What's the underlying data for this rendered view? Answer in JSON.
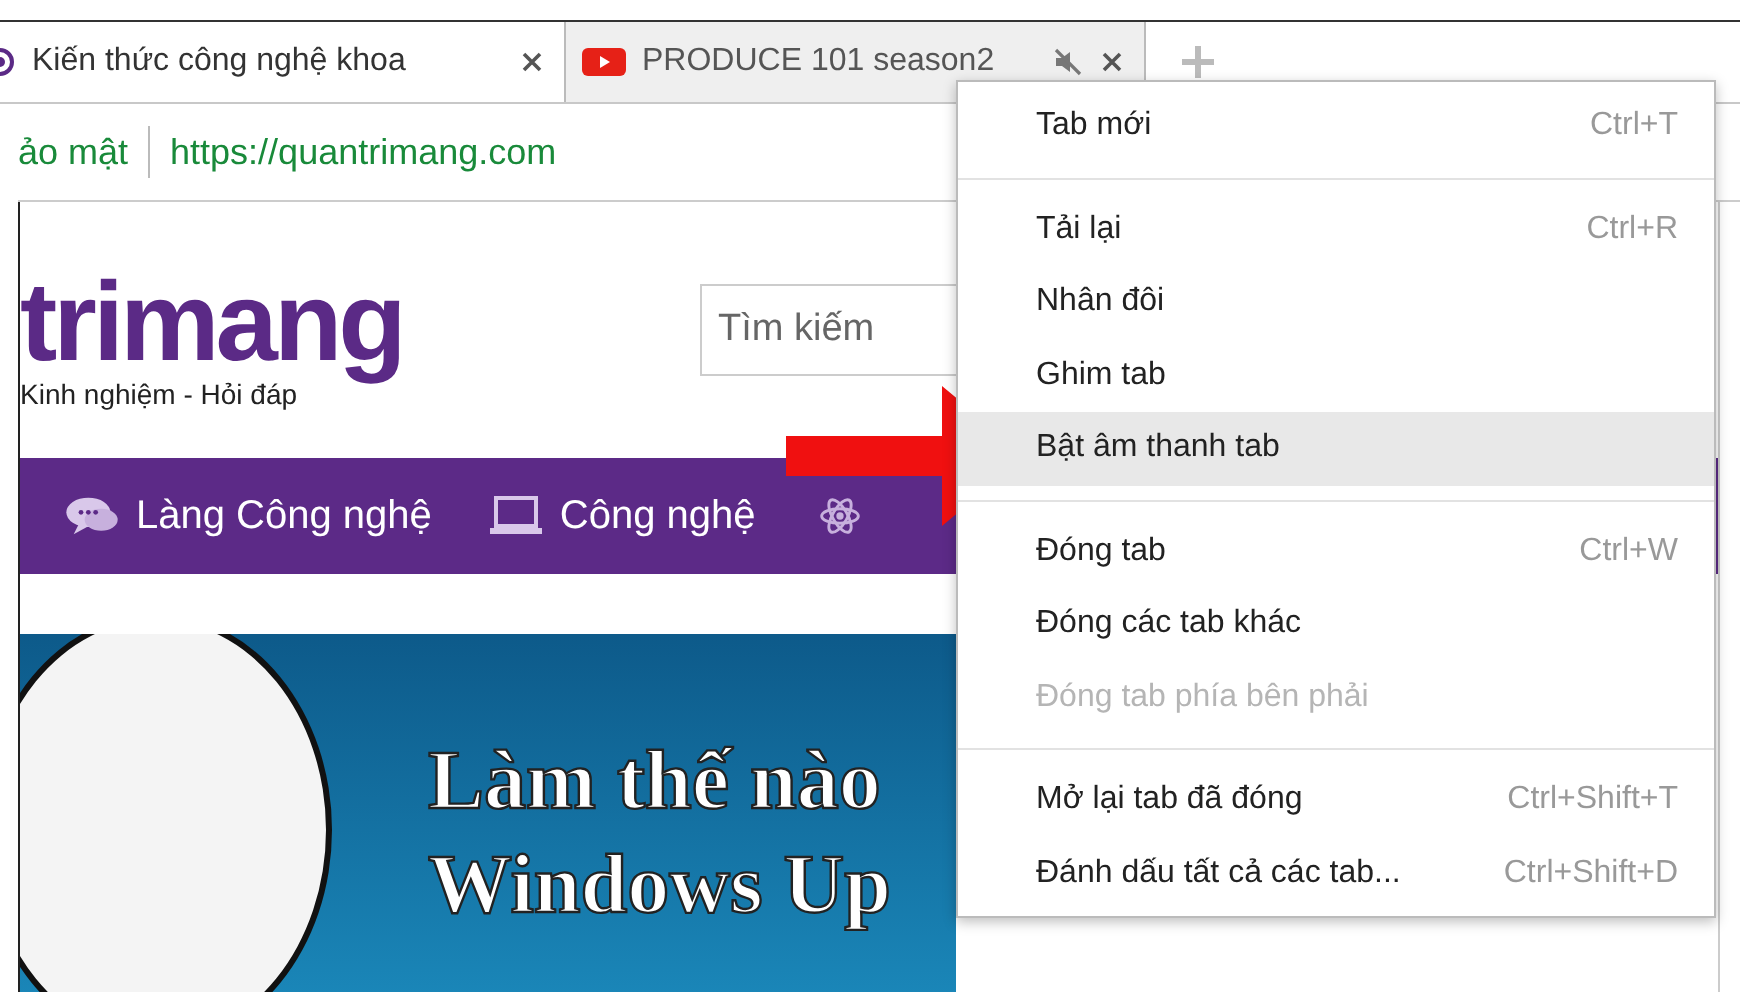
{
  "tabs": [
    {
      "title": "Kiến thức công nghệ khoa",
      "selected": true,
      "kind": "site",
      "muted": false
    },
    {
      "title": "PRODUCE 101 season2",
      "selected": false,
      "kind": "video",
      "muted": true
    }
  ],
  "address_bar": {
    "security_label": "ảo mật",
    "url": "https://quantrimang.com"
  },
  "site": {
    "logo_text": "trimang",
    "tagline": "Kinh nghiệm - Hỏi đáp",
    "search": {
      "placeholder": "Tìm kiếm"
    },
    "nav": [
      {
        "label": "Làng Công nghệ",
        "kind": "chat"
      },
      {
        "label": "Công nghệ",
        "kind": "laptop"
      },
      {
        "kind": "atom"
      }
    ],
    "banner": {
      "lines": [
        "Làm thế nào",
        "Windows Up"
      ]
    }
  },
  "context_menu": {
    "sections": [
      [
        {
          "label": "Tab mới",
          "shortcut": "Ctrl+T",
          "disabled": false,
          "selected": false
        }
      ],
      [
        {
          "label": "Tải lại",
          "shortcut": "Ctrl+R",
          "disabled": false,
          "selected": false
        },
        {
          "label": "Nhân đôi",
          "disabled": false,
          "selected": false
        },
        {
          "label": "Ghim tab",
          "disabled": false,
          "selected": false
        },
        {
          "label": "Bật âm thanh tab",
          "disabled": false,
          "selected": true
        }
      ],
      [
        {
          "label": "Đóng tab",
          "shortcut": "Ctrl+W",
          "disabled": false,
          "selected": false
        },
        {
          "label": "Đóng các tab khác",
          "disabled": false,
          "selected": false
        },
        {
          "label": "Đóng tab phía bên phải",
          "disabled": true,
          "selected": false
        }
      ],
      [
        {
          "label": "Mở lại tab đã đóng",
          "shortcut": "Ctrl+Shift+T",
          "disabled": false,
          "selected": false
        },
        {
          "label": "Đánh dấu tất cả các tab...",
          "shortcut": "Ctrl+Shift+D",
          "disabled": false,
          "selected": false
        }
      ]
    ]
  }
}
